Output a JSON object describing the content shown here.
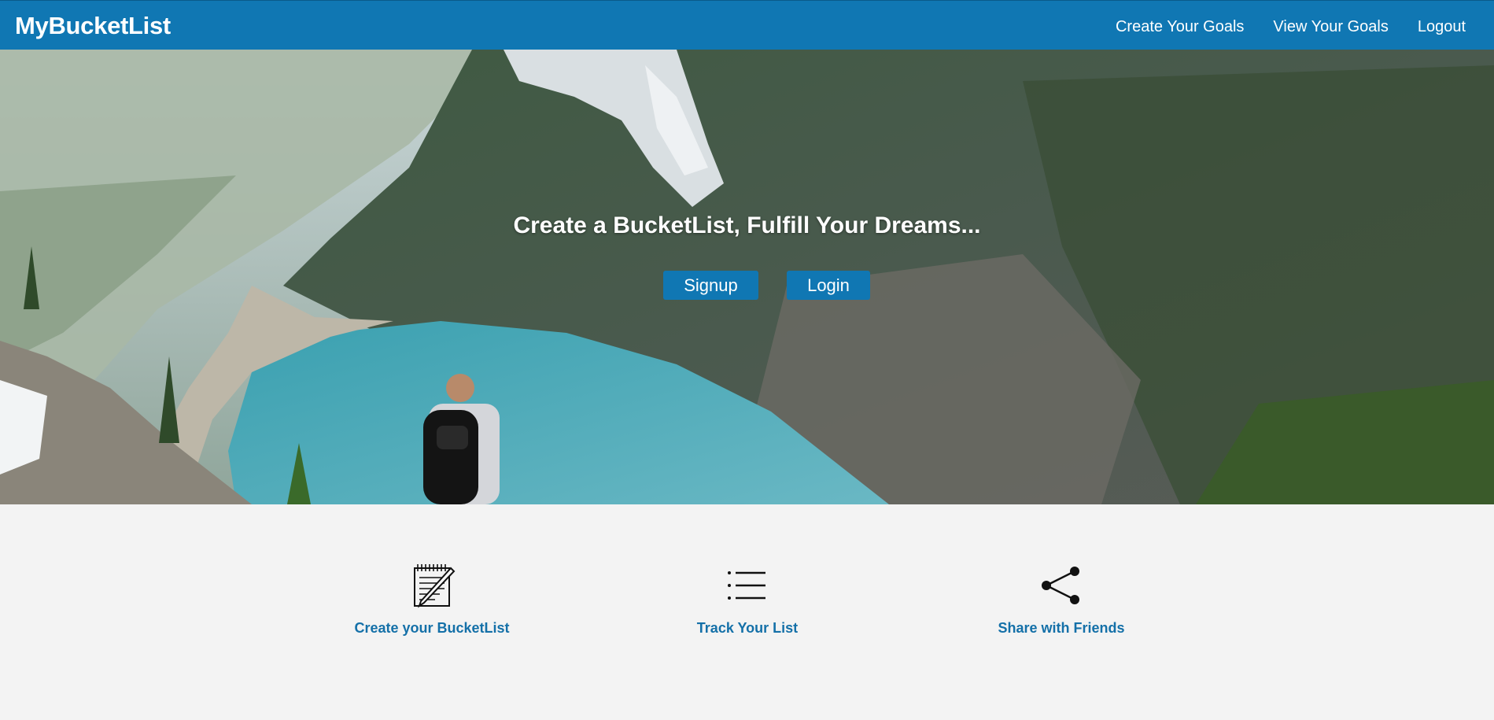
{
  "navbar": {
    "brand": "MyBucketList",
    "links": [
      {
        "label": "Create Your Goals"
      },
      {
        "label": "View Your Goals"
      },
      {
        "label": "Logout"
      }
    ],
    "color": "#1077b3"
  },
  "hero": {
    "title": "Create a BucketList, Fulfill Your Dreams...",
    "signup_label": "Signup",
    "login_label": "Login"
  },
  "features": [
    {
      "label": "Create your BucketList",
      "icon": "notepad-pencil-icon"
    },
    {
      "label": "Track Your List",
      "icon": "list-icon"
    },
    {
      "label": "Share with Friends",
      "icon": "share-icon"
    }
  ],
  "colors": {
    "accent": "#1077b3",
    "feature_text": "#1470a8",
    "background": "#f3f3f3"
  }
}
